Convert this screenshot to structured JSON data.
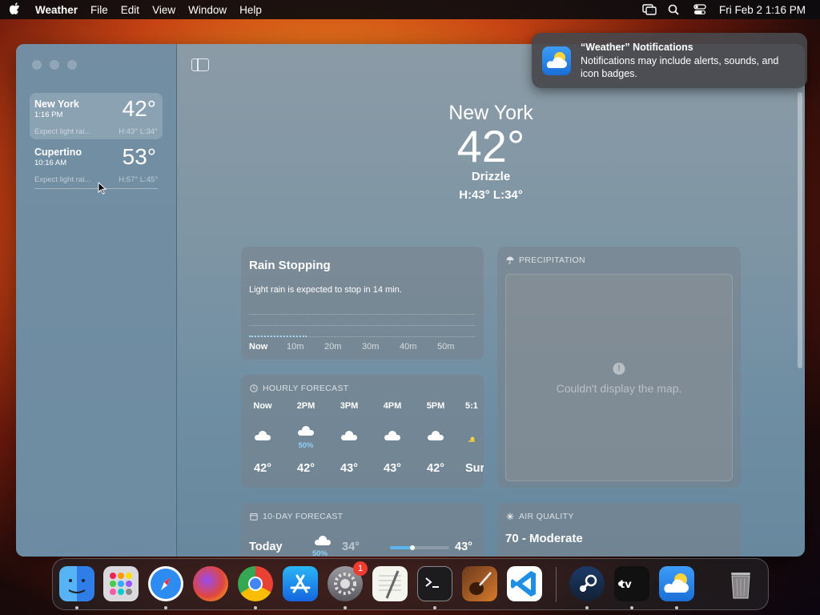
{
  "menubar": {
    "app": "Weather",
    "items": [
      "File",
      "Edit",
      "View",
      "Window",
      "Help"
    ],
    "clock": "Fri Feb 2  1:16 PM"
  },
  "sidebar": {
    "cities": [
      {
        "name": "New York",
        "time": "1:16 PM",
        "temp": "42°",
        "condition": "Expect light rai...",
        "hl": "H:43°  L:34°"
      },
      {
        "name": "Cupertino",
        "time": "10:16 AM",
        "temp": "53°",
        "condition": "Expect light rai...",
        "hl": "H:57°  L:45°"
      }
    ]
  },
  "hero": {
    "city": "New York",
    "temp": "42°",
    "condition": "Drizzle",
    "hl": "H:43°  L:34°"
  },
  "rain_card": {
    "title": "Rain Stopping",
    "desc": "Light rain is expected to stop in 14 min.",
    "ticks": [
      "Now",
      "10m",
      "20m",
      "30m",
      "40m",
      "50m"
    ]
  },
  "hourly": {
    "header": "HOURLY FORECAST",
    "hours": [
      {
        "hour": "Now",
        "pct": "",
        "temp": "42°"
      },
      {
        "hour": "2PM",
        "pct": "50%",
        "temp": "42°"
      },
      {
        "hour": "3PM",
        "pct": "",
        "temp": "43°"
      },
      {
        "hour": "4PM",
        "pct": "",
        "temp": "43°"
      },
      {
        "hour": "5PM",
        "pct": "",
        "temp": "42°"
      },
      {
        "hour": "5:1",
        "pct": "",
        "temp": "Sur"
      }
    ]
  },
  "precip": {
    "header": "PRECIPITATION",
    "message": "Couldn't display the map."
  },
  "tenday": {
    "header": "10-DAY FORECAST",
    "day": "Today",
    "pct": "50%",
    "low": "34°",
    "high": "43°"
  },
  "air": {
    "header": "AIR QUALITY",
    "value": "70 - Moderate"
  },
  "notification": {
    "title": "“Weather” Notifications",
    "body": "Notifications may include alerts, sounds, and icon badges."
  },
  "dock": {
    "settings_badge": "1",
    "apps": [
      "finder",
      "launchpad",
      "safari",
      "firefox",
      "chrome",
      "app-store",
      "system-settings",
      "textedit",
      "terminal",
      "garageband",
      "vscode",
      "steam",
      "apple-tv",
      "weather",
      "trash"
    ]
  }
}
